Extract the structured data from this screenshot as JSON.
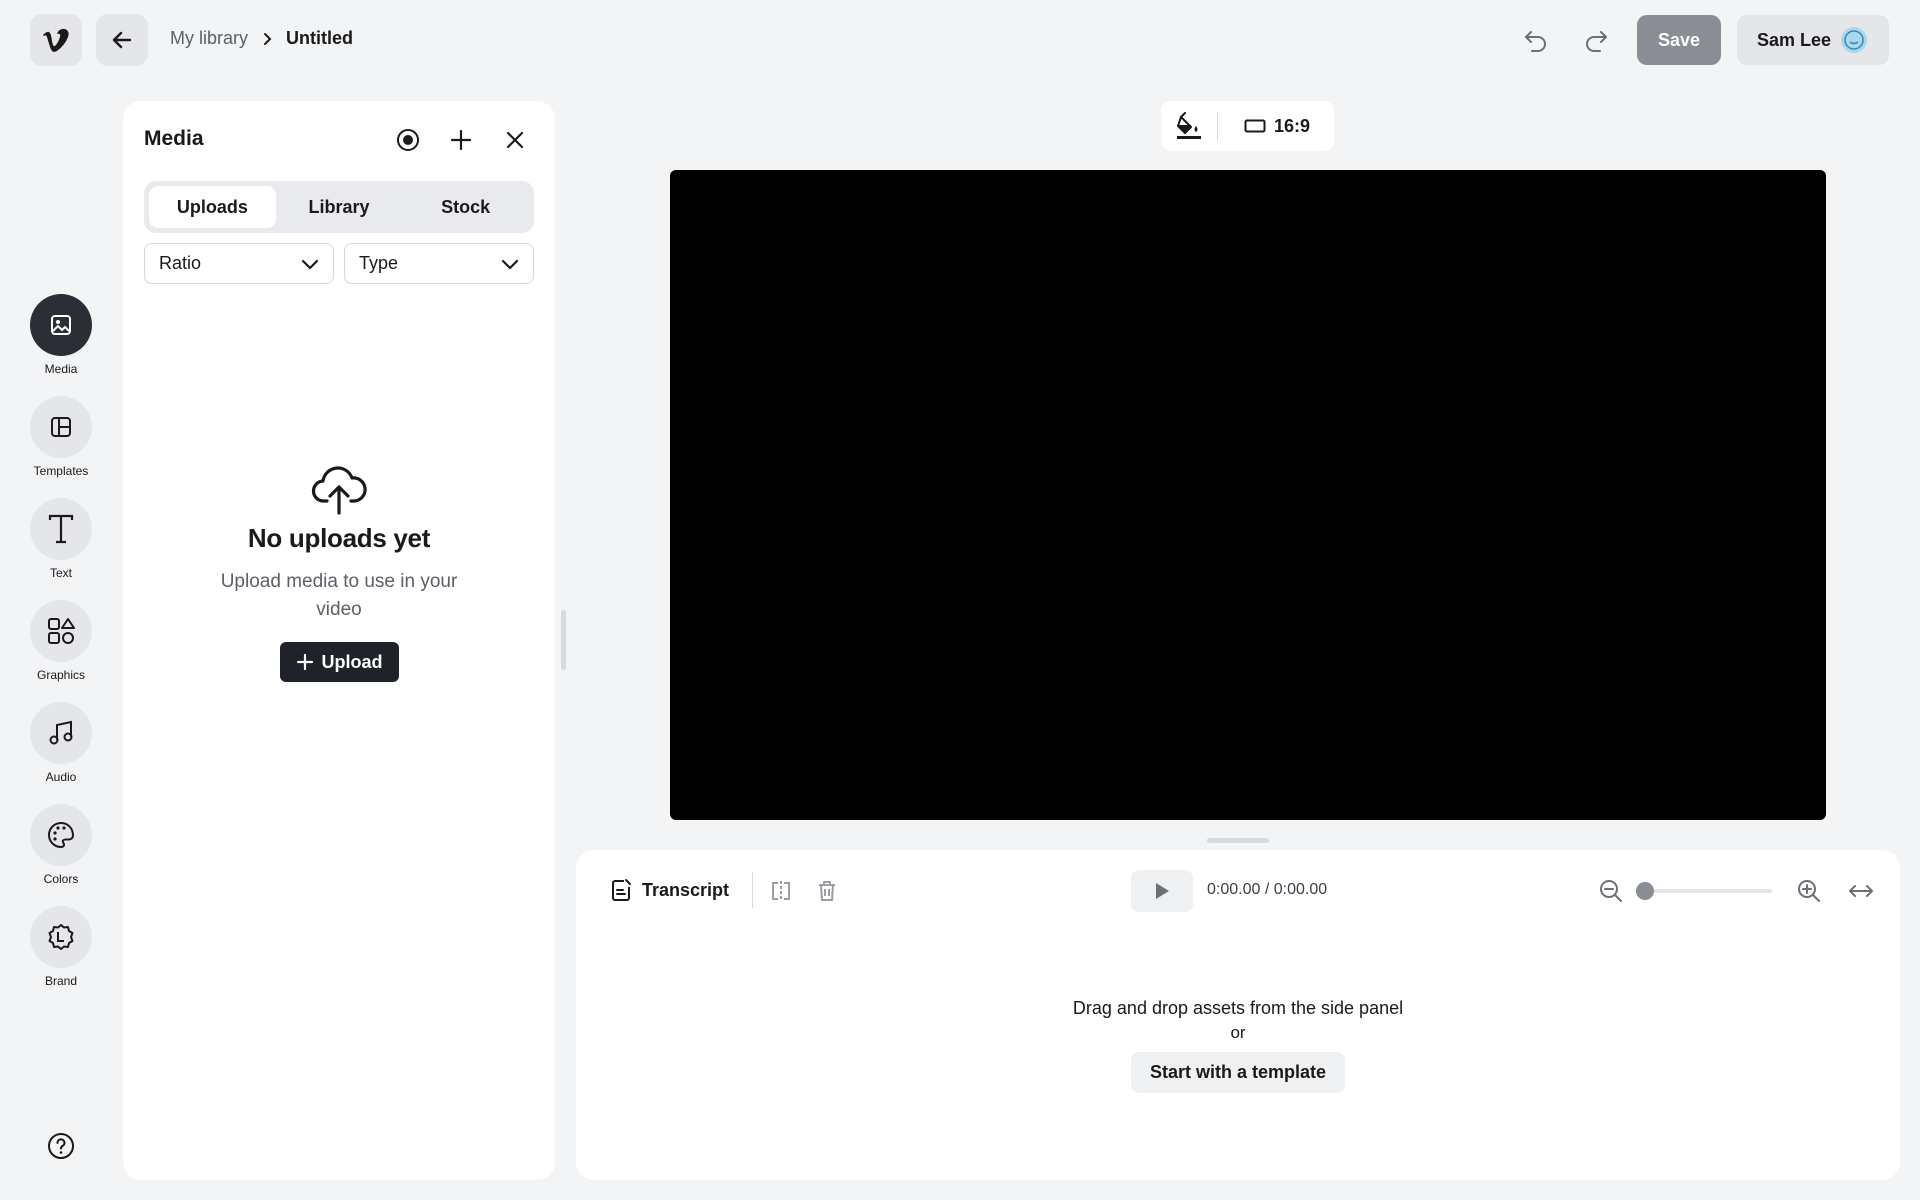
{
  "header": {
    "breadcrumb_parent": "My library",
    "breadcrumb_current": "Untitled",
    "save_label": "Save",
    "user_name": "Sam Lee"
  },
  "rail": {
    "items": [
      {
        "label": "Media",
        "icon": "image-icon",
        "active": true
      },
      {
        "label": "Templates",
        "icon": "layout-icon",
        "active": false
      },
      {
        "label": "Text",
        "icon": "text-icon",
        "active": false
      },
      {
        "label": "Graphics",
        "icon": "shapes-icon",
        "active": false
      },
      {
        "label": "Audio",
        "icon": "music-icon",
        "active": false
      },
      {
        "label": "Colors",
        "icon": "palette-icon",
        "active": false
      },
      {
        "label": "Brand",
        "icon": "brand-icon",
        "active": false
      }
    ]
  },
  "media_panel": {
    "title": "Media",
    "tabs": [
      {
        "label": "Uploads",
        "active": true
      },
      {
        "label": "Library",
        "active": false
      },
      {
        "label": "Stock",
        "active": false
      }
    ],
    "filters": {
      "ratio": "Ratio",
      "type": "Type"
    },
    "empty": {
      "title": "No uploads yet",
      "text": "Upload media to use in your video",
      "button": "Upload"
    }
  },
  "canvas": {
    "aspect_ratio": "16:9",
    "background": "#000000"
  },
  "timeline": {
    "transcript_label": "Transcript",
    "current_time": "0:00.00",
    "separator": "/",
    "total_time": "0:00.00",
    "zoom_level": 0,
    "drop_hint": "Drag and drop assets from the side panel",
    "or_label": "or",
    "template_button": "Start with a template"
  },
  "colors": {
    "accent": "#1f2329",
    "save_disabled": "#8a8d93",
    "avatar": "#a7d8f0"
  }
}
